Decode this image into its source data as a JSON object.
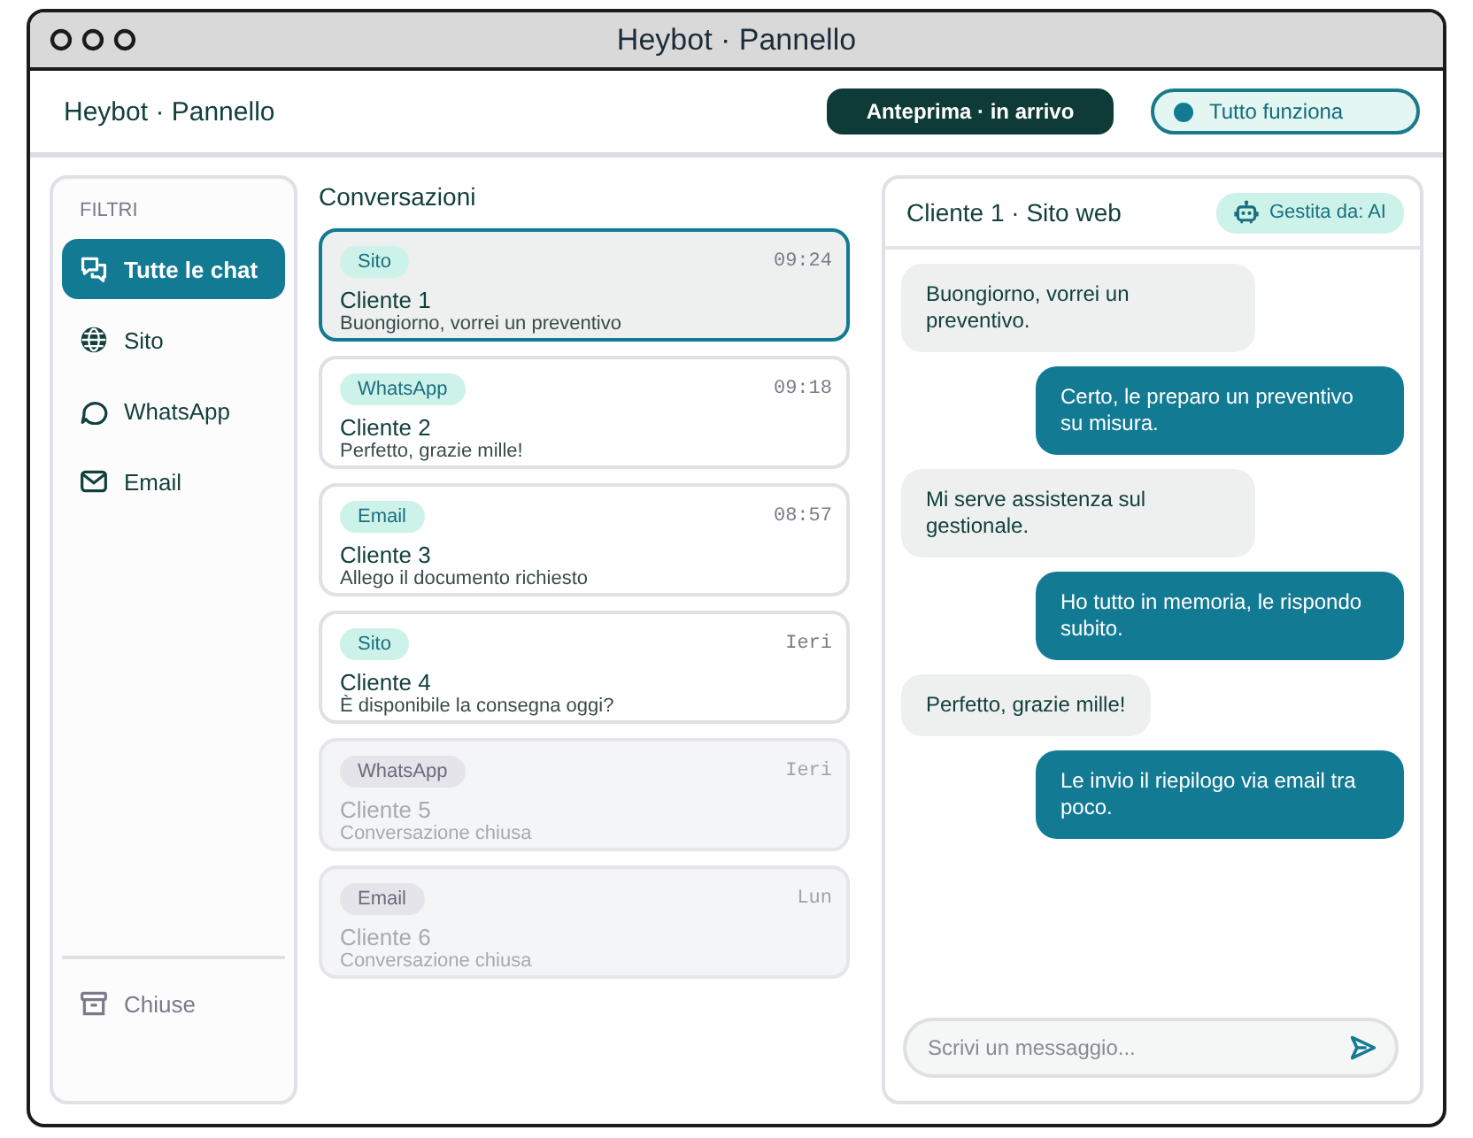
{
  "window": {
    "title": "Heybot · Pannello"
  },
  "header": {
    "brand": "Heybot · Pannello",
    "preview_button": {
      "label": "Anteprima · in arrivo"
    },
    "status": {
      "label": "Tutto funziona"
    }
  },
  "sidebar": {
    "section_label": "FILTRI",
    "items": [
      {
        "label": "Tutte le chat",
        "selected": true
      },
      {
        "label": "Sito",
        "selected": false
      },
      {
        "label": "WhatsApp",
        "selected": false
      },
      {
        "label": "Email",
        "selected": false
      }
    ],
    "footer_item": {
      "label": "Chiuse"
    }
  },
  "conversations": {
    "title": "Conversazioni",
    "items": [
      {
        "channel": "Sito",
        "time": "09:24",
        "name": "Cliente 1",
        "preview": "Buongiorno, vorrei un preventivo",
        "selected": true,
        "closed": false
      },
      {
        "channel": "WhatsApp",
        "time": "09:18",
        "name": "Cliente 2",
        "preview": "Perfetto, grazie mille!",
        "selected": false,
        "closed": false
      },
      {
        "channel": "Email",
        "time": "08:57",
        "name": "Cliente 3",
        "preview": "Allego il documento richiesto",
        "selected": false,
        "closed": false
      },
      {
        "channel": "Sito",
        "time": "Ieri",
        "name": "Cliente 4",
        "preview": "È disponibile la consegna oggi?",
        "selected": false,
        "closed": false
      },
      {
        "channel": "WhatsApp",
        "time": "Ieri",
        "name": "Cliente 5",
        "preview": "Conversazione chiusa",
        "selected": false,
        "closed": true
      },
      {
        "channel": "Email",
        "time": "Lun",
        "name": "Cliente 6",
        "preview": "Conversazione chiusa",
        "selected": false,
        "closed": true
      }
    ]
  },
  "chat": {
    "title": "Cliente 1 · Sito web",
    "handler_badge": "Gestita da: AI",
    "messages": [
      {
        "kind": "incoming",
        "text": "Buongiorno, vorrei un preventivo."
      },
      {
        "kind": "outgoing",
        "text": "Certo, le preparo un preventivo su misura."
      },
      {
        "kind": "incoming",
        "text": "Mi serve assistenza sul gestionale."
      },
      {
        "kind": "outgoing",
        "text": "Ho tutto in memoria, le rispondo subito."
      },
      {
        "kind": "incoming",
        "text": "Perfetto, grazie mille!"
      },
      {
        "kind": "outgoing",
        "text": "Le invio il riepilogo via email tra poco."
      }
    ],
    "composer": {
      "placeholder": "Scrivi un messaggio..."
    }
  }
}
